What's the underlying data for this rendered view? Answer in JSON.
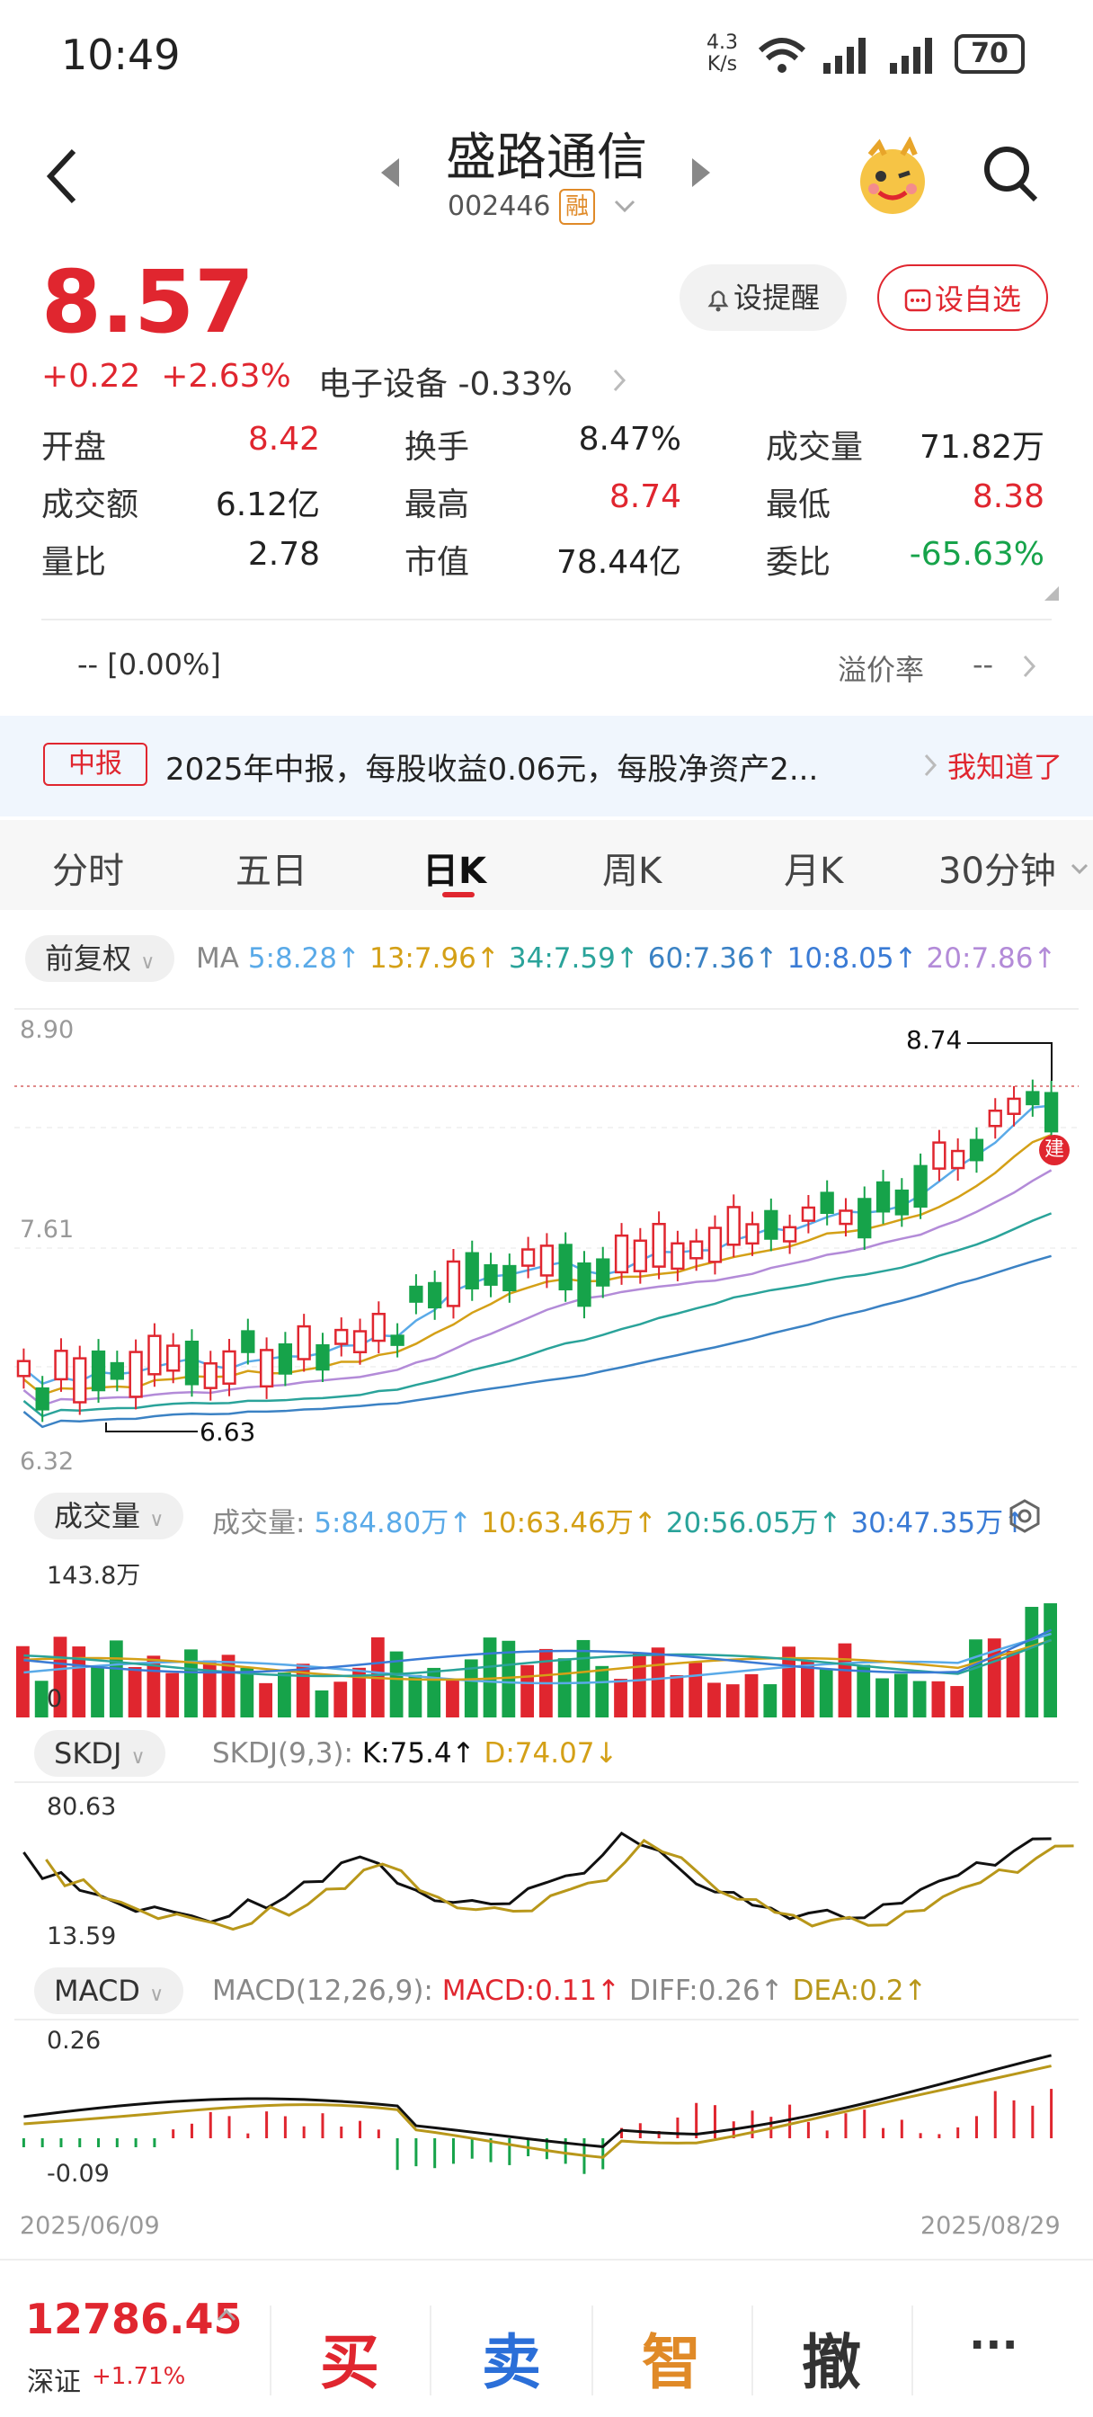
{
  "status_bar": {
    "time": "10:49",
    "net_speed_value": "4.3",
    "net_speed_unit": "K/s",
    "battery": "70"
  },
  "header": {
    "stock_name": "盛路通信",
    "stock_code": "002446",
    "margin_badge": "融"
  },
  "price": {
    "last": "8.57",
    "change": "+0.22",
    "change_pct": "+2.63%",
    "sector": "电子设备",
    "sector_change": "-0.33%"
  },
  "buttons": {
    "alert": "设提醒",
    "add_watch": "设自选"
  },
  "quote": [
    [
      {
        "label": "开盘",
        "value": "8.42",
        "color": "red"
      },
      {
        "label": "换手",
        "value": "8.47%",
        "color": "black"
      },
      {
        "label": "成交量",
        "value": "71.82万",
        "color": "black"
      }
    ],
    [
      {
        "label": "成交额",
        "value": "6.12亿",
        "color": "black"
      },
      {
        "label": "最高",
        "value": "8.74",
        "color": "red"
      },
      {
        "label": "最低",
        "value": "8.38",
        "color": "red"
      }
    ],
    [
      {
        "label": "量比",
        "value": "2.78",
        "color": "black"
      },
      {
        "label": "市值",
        "value": "78.44亿",
        "color": "black"
      },
      {
        "label": "委比",
        "value": "-65.63%",
        "color": "green"
      }
    ]
  ],
  "premium": {
    "left": "-- [0.00%]",
    "label": "溢价率",
    "value": "--"
  },
  "notice": {
    "tag": "中报",
    "text": "2025年中报，每股收益0.06元，每股净资产2...",
    "action": "我知道了"
  },
  "tabs": [
    "分时",
    "五日",
    "日K",
    "周K",
    "月K",
    "30分钟"
  ],
  "active_tab": "日K",
  "kline": {
    "adjust": "前复权",
    "ma_prefix": "MA",
    "ma": [
      {
        "text": "5:8.28↑",
        "color": "#5aaae8"
      },
      {
        "text": "13:7.96↑",
        "color": "#d4a017"
      },
      {
        "text": "34:7.59↑",
        "color": "#2aa39a"
      },
      {
        "text": "60:7.36↑",
        "color": "#3b82c4"
      },
      {
        "text": "10:8.05↑",
        "color": "#3a7bd5"
      },
      {
        "text": "20:7.86↑",
        "color": "#b38bd8"
      }
    ],
    "y_top": "8.90",
    "y_mid": "7.61",
    "y_bottom": "6.32",
    "high_label": "8.74",
    "low_label": "6.63",
    "build_badge": "建"
  },
  "volume": {
    "chip": "成交量",
    "title": "成交量:",
    "ma": [
      {
        "text": "5:84.80万↑",
        "color": "#5aaae8"
      },
      {
        "text": "10:63.46万↑",
        "color": "#d4a017"
      },
      {
        "text": "20:56.05万↑",
        "color": "#2aa39a"
      },
      {
        "text": "30:47.35万↑",
        "color": "#3a7bd5"
      }
    ],
    "y_top": "143.8万",
    "y_bottom": "0"
  },
  "skdj": {
    "chip": "SKDJ",
    "title": "SKDJ(9,3):",
    "k": "K:75.4↑",
    "d": "D:74.07↓",
    "y_top": "80.63",
    "y_bottom": "13.59"
  },
  "macd": {
    "chip": "MACD",
    "title": "MACD(12,26,9):",
    "macd": "MACD:0.11↑",
    "diff": "DIFF:0.26↑",
    "dea": "DEA:0.2↑",
    "y_top": "0.26",
    "y_bottom": "-0.09"
  },
  "dates": {
    "start": "2025/06/09",
    "end": "2025/08/29"
  },
  "bottom": {
    "index_value": "12786.45",
    "index_name": "深证",
    "index_change": "+1.71%",
    "buy": "买",
    "sell": "卖",
    "smart": "智",
    "cancel": "撤",
    "more": "···"
  },
  "colors": {
    "up": "#e0262f",
    "down": "#16a34a",
    "dea": "#b8971a",
    "diff": "#111111"
  }
}
